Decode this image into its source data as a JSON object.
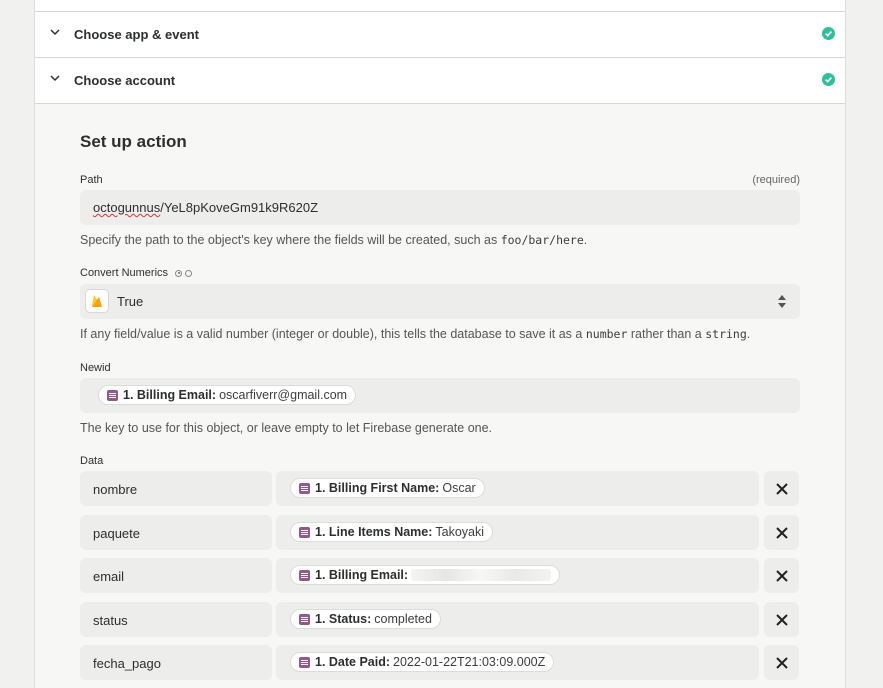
{
  "steps": {
    "app_event": "Choose app & event",
    "account": "Choose account"
  },
  "colors": {
    "check": "#2fc09a",
    "pill_icon": "#96588a",
    "firebase": "#f5a623"
  },
  "setup": {
    "title": "Set up action",
    "path": {
      "label": "Path",
      "required": "(required)",
      "value_underlined": "octogunnus",
      "value_rest": "/YeL8pKoveGm91k9R620Z",
      "hint_prefix": "Specify the path to the object's key where the fields will be created, such as ",
      "hint_code": "foo/bar/here",
      "hint_suffix": "."
    },
    "convert": {
      "label": "Convert Numerics",
      "value": "True",
      "hint_1": "If any field/value is a valid number (integer or double), this tells the database to save it as a ",
      "hint_code1": "number",
      "hint_2": " rather than a ",
      "hint_code2": "string",
      "hint_3": "."
    },
    "newid": {
      "label": "Newid",
      "pill_key": "1. Billing Email:",
      "pill_value": "oscarfiverr@gmail.com",
      "hint": "The key to use for this object, or leave empty to let Firebase generate one."
    },
    "data": {
      "label": "Data",
      "rows": [
        {
          "key": "nombre",
          "pill_key": "1. Billing First Name:",
          "pill_value": "Oscar"
        },
        {
          "key": "paquete",
          "pill_key": "1. Line Items Name:",
          "pill_value": "Takoyaki"
        },
        {
          "key": "email",
          "pill_key": "1. Billing Email:",
          "pill_value": ""
        },
        {
          "key": "status",
          "pill_key": "1. Status:",
          "pill_value": "completed"
        },
        {
          "key": "fecha_pago",
          "pill_key": "1. Date Paid:",
          "pill_value": "2022-01-22T21:03:09.000Z"
        }
      ]
    }
  }
}
